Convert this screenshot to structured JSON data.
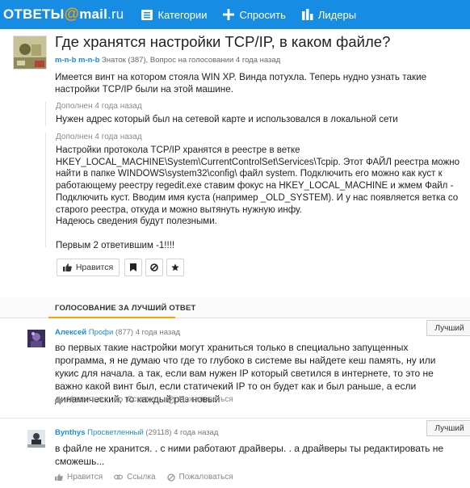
{
  "header": {
    "logo_main": "ОТВЕТЫ",
    "logo_at": "@",
    "logo_mail": "mail",
    "logo_ru": ".ru",
    "nav": {
      "categories": "Категории",
      "ask": "Спросить",
      "leaders": "Лидеры"
    }
  },
  "question": {
    "title": "Где хранятся настройки TCP/IP, в каком файле?",
    "author": "m-n-b m-n-b",
    "meta": "Знаток (387), Вопрос на голосовании 4 года назад",
    "body": "Имеется винт на котором стояла WIN XP. Винда потухла. Теперь нудно узнать такие настройки TCP/IP были на этой машине.",
    "addenda": [
      {
        "label": "Дополнен 4 года назад",
        "text": "Нужен адрес который был на сетевой карте и использовался в локальной сети"
      },
      {
        "label": "Дополнен 4 года назад",
        "text": "Настройки протокола TCP/IP хранятся в реестре в ветке\nHKEY_LOCAL_MACHINE\\System\\CurrentControlSet\\Services\\Tcpip. Этот ФАЙЛ реестра можно найти в папке WINDOWS\\system32\\config\\ файл system. Подключить его можно как куст к работающему реестру regedit.exe ставим фокус на HKEY_LOCAL_MACHINE и жмем Файл - Подключить куст. Вводим имя куста (например _OLD_SYSTEM). И у нас появляется ветка со старого реестра, откуда и можно вытянуть нужную инфу.\nНадеюсь сведения будут полезными.\n\nПервым 2 ответившим -1!!!!"
      }
    ],
    "like_label": "Нравится"
  },
  "voting": {
    "title": "ГОЛОСОВАНИЕ ЗА ЛУЧШИЙ ОТВЕТ"
  },
  "answers": [
    {
      "author": "Алексей",
      "rank": "Профи",
      "meta": "(877) 4 года назад",
      "text": "во первых такие настройки могут храниться только в специально запущенных программа, я не думаю что где то глубоко в системе вы найдете кеш память, ну или кукис для начала. а так, если вам нужен IP который светился в интернете, то это не важно какой винт был, если статичекий IP то он будет как и был раньше, а если динамический, то каждый раз новый",
      "best_label": "Лучший",
      "like_label": "Нравится",
      "link_label": "Ссылка",
      "report_label": "Пожаловаться"
    },
    {
      "author": "Bynthys",
      "rank": "Просветленный",
      "meta": "(29118) 4 года назад",
      "text": "в файле не хранится. . с ними работают драйверы. . а драйверы ты редактировать не сможешь...",
      "best_label": "Лучший",
      "like_label": "Нравится",
      "link_label": "Ссылка",
      "report_label": "Пожаловаться"
    }
  ],
  "colors": {
    "header_bg": "#168de2",
    "accent_orange": "#ff9e00",
    "link_blue": "#168de2"
  }
}
